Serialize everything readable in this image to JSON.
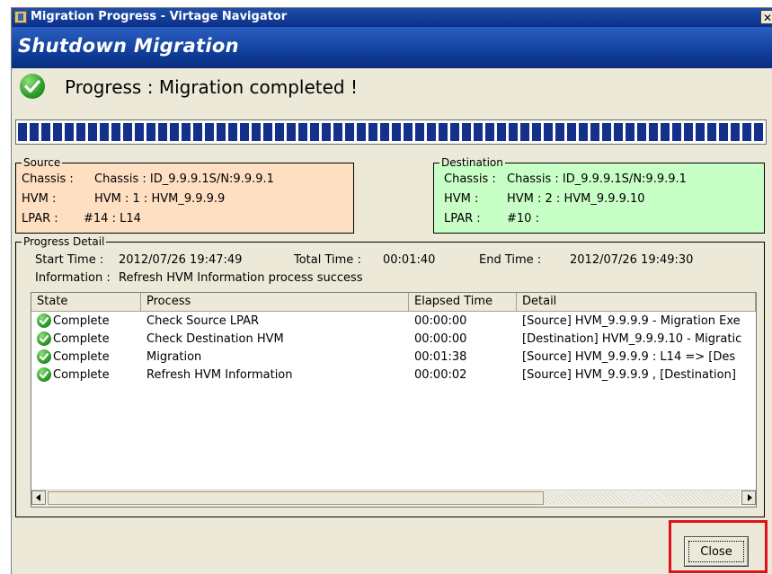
{
  "window": {
    "title": "Migration Progress - Virtage Navigator",
    "close_glyph": "✕"
  },
  "banner": {
    "title": "Shutdown Migration"
  },
  "progress": {
    "label": "Progress",
    "separator": ":",
    "status": "Migration completed !",
    "fraction": 1.0
  },
  "source": {
    "legend": "Source",
    "chassis_label": "Chassis :",
    "chassis_value": "Chassis : ID_9.9.9.1S/N:9.9.9.1",
    "hvm_label": "HVM :",
    "hvm_value": "HVM : 1 : HVM_9.9.9.9",
    "lpar_label": "LPAR :",
    "lpar_value": "#14 : L14"
  },
  "destination": {
    "legend": "Destination",
    "chassis_label": "Chassis :",
    "chassis_value": "Chassis : ID_9.9.9.1S/N:9.9.9.1",
    "hvm_label": "HVM :",
    "hvm_value": "HVM : 2 : HVM_9.9.9.10",
    "lpar_label": "LPAR :",
    "lpar_value": "#10 :"
  },
  "detail": {
    "legend": "Progress Detail",
    "start_label": "Start Time :",
    "start_value": "2012/07/26 19:47:49",
    "total_label": "Total Time :",
    "total_value": "00:01:40",
    "end_label": "End Time :",
    "end_value": "2012/07/26 19:49:30",
    "info_label": "Information :",
    "info_value": "Refresh HVM Information process success"
  },
  "table": {
    "columns": [
      "State",
      "Process",
      "Elapsed Time",
      "Detail"
    ],
    "rows": [
      {
        "state": "Complete",
        "process": "Check Source LPAR",
        "elapsed": "00:00:00",
        "detail": "[Source] HVM_9.9.9.9    - Migration Exe"
      },
      {
        "state": "Complete",
        "process": "Check Destination HVM",
        "elapsed": "00:00:00",
        "detail": "[Destination] HVM_9.9.9.10    - Migratic"
      },
      {
        "state": "Complete",
        "process": "Migration",
        "elapsed": "00:01:38",
        "detail": "[Source] HVM_9.9.9.9    : L14 => [Des"
      },
      {
        "state": "Complete",
        "process": "Refresh HVM Information",
        "elapsed": "00:00:02",
        "detail": "[Source] HVM_9.9.9.9    , [Destination]"
      }
    ]
  },
  "buttons": {
    "close": "Close"
  },
  "colors": {
    "accent": "#0e3a96",
    "source_bg": "#ffdfc2",
    "destination_bg": "#c8ffc6",
    "highlight": "#e0101a"
  },
  "icons": {
    "state": "check-circle-icon",
    "status": "check-circle-icon"
  }
}
